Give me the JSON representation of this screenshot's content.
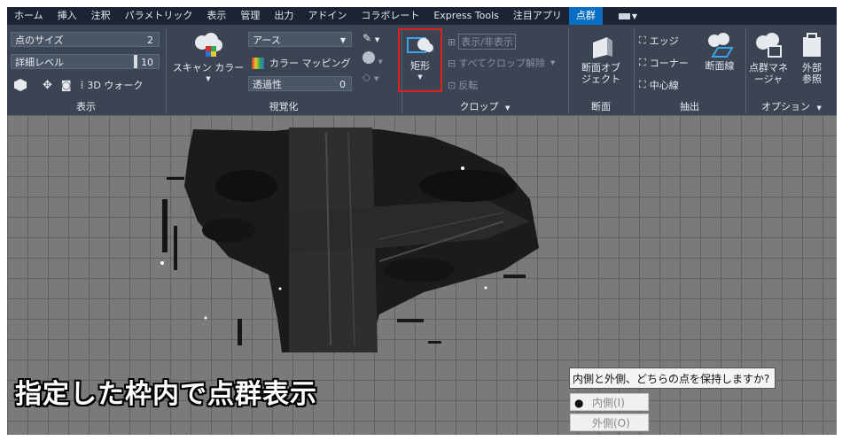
{
  "tabs": [
    "ホーム",
    "挿入",
    "注釈",
    "パラメトリック",
    "表示",
    "管理",
    "出力",
    "アドイン",
    "コラボレート",
    "Express Tools",
    "注目アプリ",
    "点群"
  ],
  "active_tab": "点群",
  "display_group": {
    "point_size_label": "点のサイズ",
    "point_size_value": "2",
    "detail_level_label": "詳細レベル",
    "detail_level_value": "10",
    "walk_label": "3D ウォーク",
    "footer": "表示"
  },
  "visualization_group": {
    "scan_color_label": "スキャン カラー",
    "color_style_value": "アース",
    "color_mapping_label": "カラー マッピング",
    "transparency_label": "透過性",
    "transparency_value": "0",
    "footer": "視覚化"
  },
  "crop_group": {
    "rectangle_label": "矩形",
    "show_hide_label": "表示/非表示",
    "uncrop_all_label": "すべてクロップ解除",
    "invert_label": "反転",
    "footer": "クロップ"
  },
  "section_group": {
    "section_object_label": "断面オブジェクト",
    "footer": "断面"
  },
  "extract_group": {
    "edge_label": "エッジ",
    "corner_label": "コーナー",
    "centerline_label": "中心線",
    "section_line_label": "断面線",
    "footer": "抽出"
  },
  "options_group": {
    "manager_label": "点群マネージャ",
    "external_ref_label": "外部参照",
    "footer": "オプション"
  },
  "overlay_caption": "指定した枠内で点群表示",
  "prompt": {
    "question": "内側と外側、どちらの点を保持しますか?",
    "options": [
      "内側(I)",
      "外側(O)"
    ],
    "selected": "内側(I)"
  },
  "colors": {
    "ribbon_bg": "#3b4453",
    "tabbar_bg": "#1c2433",
    "active_tab": "#0a6fc2",
    "highlight_box": "#e02020",
    "viewport_bg": "#7a7a7a"
  }
}
